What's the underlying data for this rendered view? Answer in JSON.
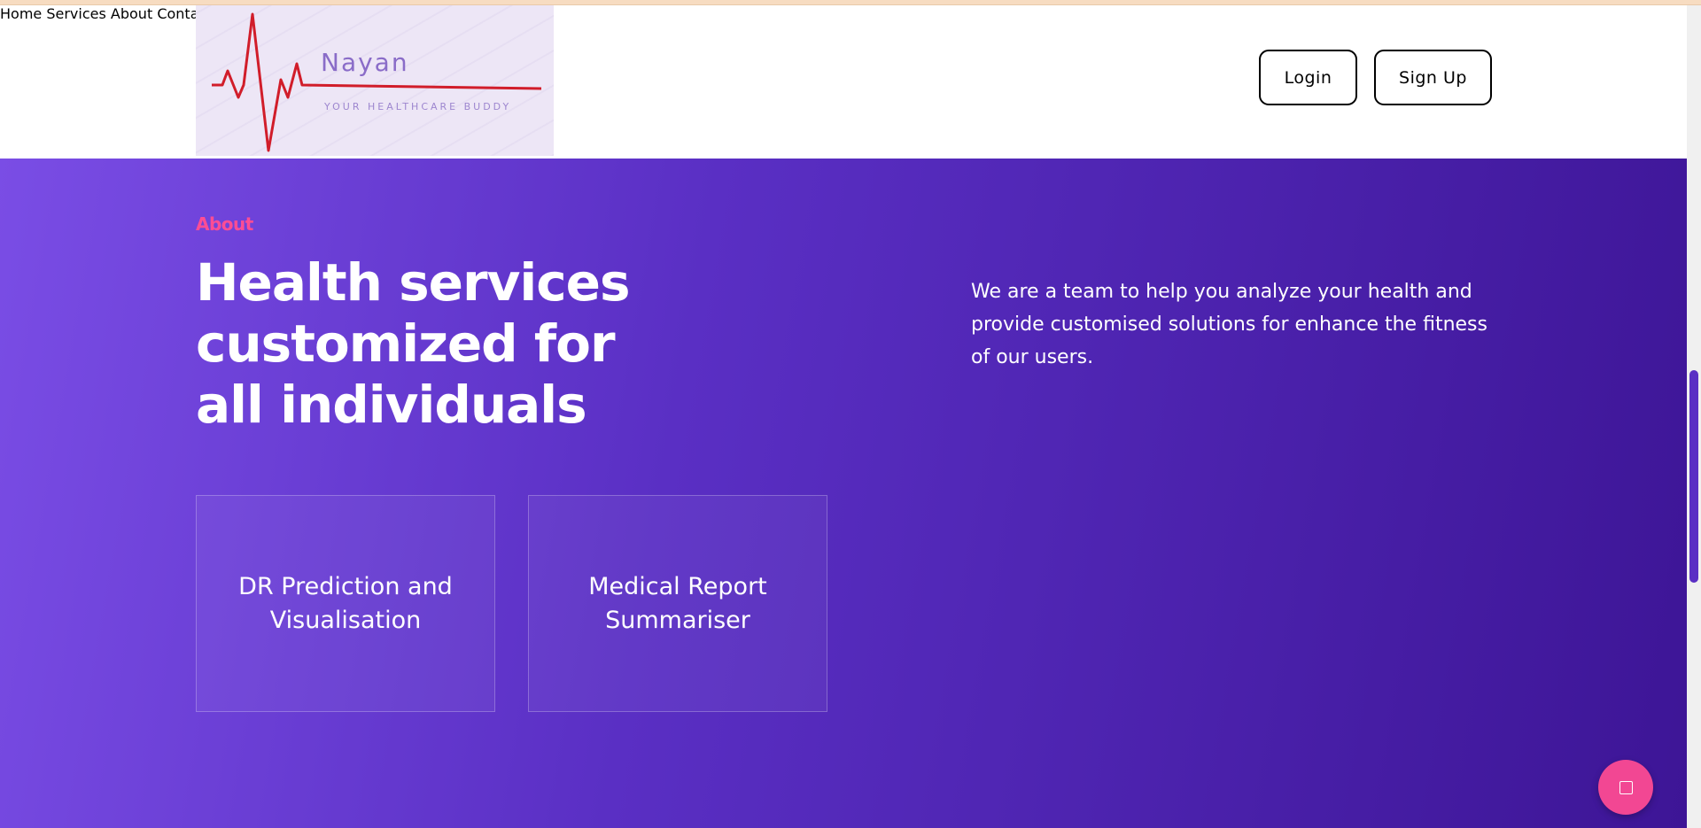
{
  "logo": {
    "name": "Nayan",
    "tagline": "YOUR HEALTHCARE BUDDY"
  },
  "nav": {
    "items": [
      "Home",
      "Services",
      "About",
      "Contact"
    ]
  },
  "auth": {
    "login_label": "Login",
    "signup_label": "Sign Up"
  },
  "hero": {
    "eyebrow": "About",
    "headline": "Health services customized for all individuals",
    "description": "We are a team to help you analyze your health and provide customised solutions for enhance the fitness of our users."
  },
  "cards": [
    {
      "label": "DR Prediction and Visualisation"
    },
    {
      "label": "Medical Report Summariser"
    }
  ],
  "colors": {
    "accent": "#ff4d94",
    "gradient_start": "#7a4de5",
    "gradient_end": "#3d1596",
    "fab": "#f24793"
  }
}
